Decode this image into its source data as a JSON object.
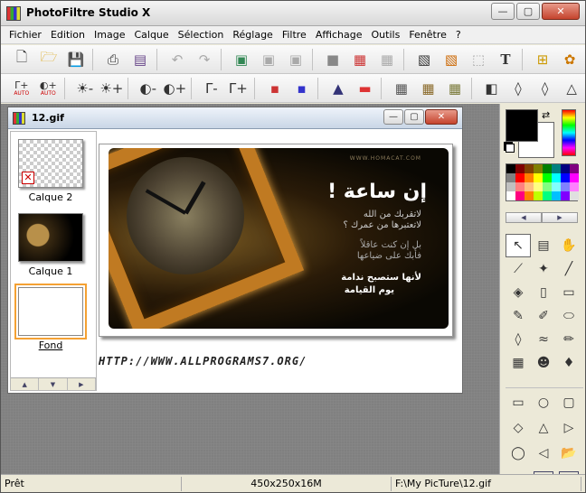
{
  "app": {
    "title": "PhotoFiltre Studio X",
    "minimize_glyph": "—",
    "maximize_glyph": "▢",
    "close_glyph": "✕"
  },
  "menu": [
    "Fichier",
    "Edition",
    "Image",
    "Calque",
    "Sélection",
    "Réglage",
    "Filtre",
    "Affichage",
    "Outils",
    "Fenêtre",
    "?"
  ],
  "toolbar1": {
    "icons": [
      "new-file-icon",
      "open-folder-icon",
      "save-icon",
      "print-icon",
      "scan-icon",
      "undo-icon",
      "redo-icon",
      "image-icon",
      "image-dim-icon",
      "image-dim-icon",
      "square-gray-icon",
      "color-palette-icon",
      "transparency-icon",
      "animation-icon",
      "export-icon",
      "selection-icon",
      "text-tool-icon",
      "tree-layers-icon",
      "automation-icon"
    ],
    "disabled": [
      2,
      5,
      6,
      8,
      9,
      12,
      15
    ]
  },
  "toolbar2": {
    "auto_label": "AUTO",
    "glyphs": [
      "Γ+",
      "◐+",
      "☀-",
      "☀+",
      "◐-",
      "◐+",
      "Γ-",
      "Γ+",
      "▪",
      "▪",
      "▲",
      "▬",
      "▦",
      "▦",
      "▦",
      "◧",
      "◊",
      "◊",
      "△"
    ]
  },
  "document": {
    "filename": "12.gif",
    "layers": [
      {
        "label": "Calque 2",
        "style": "checker",
        "hidden": true,
        "selected": false
      },
      {
        "label": "Calque 1",
        "style": "photo",
        "hidden": false,
        "selected": false
      },
      {
        "label": "Fond",
        "style": "white",
        "hidden": false,
        "selected": true
      }
    ],
    "hidden_glyph": "✕",
    "panel_scroll_glyphs": [
      "▲",
      "▼",
      "▶"
    ],
    "image": {
      "site": "WWW.HOMACAT.COM",
      "ar_title": "إن ساعة !",
      "ar_lines": [
        "لاتقربك من الله",
        "لاتعتبرها من عمرك ؟",
        "بل إن كنت عاقلاً",
        "فأبك على ضياعها",
        "لأنها ستصبح ندامة",
        "يوم القيامة"
      ]
    },
    "url_text": "HTTP://WWW.ALLPROGRAMS7.ORG/"
  },
  "palette": {
    "colors": [
      "#000000",
      "#800000",
      "#804000",
      "#808000",
      "#008000",
      "#008080",
      "#000080",
      "#800080",
      "#808080",
      "#ff0000",
      "#ff8000",
      "#ffff00",
      "#00ff00",
      "#00ffff",
      "#0000ff",
      "#ff00ff",
      "#c0c0c0",
      "#ff8080",
      "#ffc080",
      "#ffff80",
      "#80ff80",
      "#80ffff",
      "#8080ff",
      "#ff80ff",
      "#ffffff",
      "#ff0080",
      "#ff8000",
      "#c0ff00",
      "#00ff80",
      "#00c0ff",
      "#8000ff",
      "#e0e0e0"
    ],
    "scroll_glyphs": [
      "◀",
      "▶"
    ]
  },
  "colors": {
    "foreground": "#000000",
    "background": "#ffffff",
    "swap_glyph": "⇄"
  },
  "tools": [
    {
      "name": "selection-arrow-icon",
      "glyph": "↖",
      "active": true
    },
    {
      "name": "image-picker-icon",
      "glyph": "▤"
    },
    {
      "name": "hand-icon",
      "glyph": "✋"
    },
    {
      "name": "eyedropper-icon",
      "glyph": "⟋"
    },
    {
      "name": "magic-wand-icon",
      "glyph": "✦"
    },
    {
      "name": "line-icon",
      "glyph": "╱"
    },
    {
      "name": "paint-bucket-icon",
      "glyph": "◈"
    },
    {
      "name": "spray-icon",
      "glyph": "▯"
    },
    {
      "name": "eraser-icon",
      "glyph": "▭"
    },
    {
      "name": "brush-icon",
      "glyph": "✎"
    },
    {
      "name": "advanced-brush-icon",
      "glyph": "✐"
    },
    {
      "name": "stamp-icon",
      "glyph": "⬭"
    },
    {
      "name": "blur-drop-icon",
      "glyph": "◊"
    },
    {
      "name": "smudge-icon",
      "glyph": "≈"
    },
    {
      "name": "clone-brush-icon",
      "glyph": "✏"
    },
    {
      "name": "pattern-icon",
      "glyph": "▦"
    },
    {
      "name": "portrait-icon",
      "glyph": "☻"
    },
    {
      "name": "strawberry-icon",
      "glyph": "♦"
    }
  ],
  "shape_tools": [
    {
      "name": "rectangle-shape-icon",
      "glyph": "▭"
    },
    {
      "name": "ellipse-shape-icon",
      "glyph": "○"
    },
    {
      "name": "rounded-rect-shape-icon",
      "glyph": "▢"
    },
    {
      "name": "diamond-shape-icon",
      "glyph": "◇"
    },
    {
      "name": "triangle-shape-icon",
      "glyph": "△"
    },
    {
      "name": "triangle-right-shape-icon",
      "glyph": "▷"
    },
    {
      "name": "lasso-shape-icon",
      "glyph": "◯"
    },
    {
      "name": "polygon-shape-icon",
      "glyph": "◁"
    },
    {
      "name": "open-shape-icon",
      "glyph": "📂"
    },
    {
      "name": "fill-mode-icon",
      "glyph": "▬"
    },
    {
      "name": "ratio-4-3-icon",
      "glyph": "4:3"
    },
    {
      "name": "ratio-3-2-icon",
      "glyph": "3:2"
    }
  ],
  "status": {
    "state": "Prêt",
    "dimensions": "450x250x16M",
    "path": "F:\\My PicTure\\12.gif"
  }
}
